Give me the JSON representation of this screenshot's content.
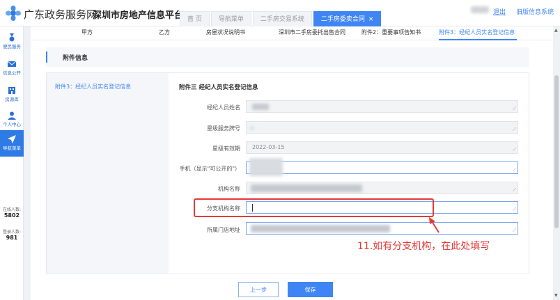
{
  "header": {
    "brand": "广东政务服务网",
    "platform": "深圳市房地产信息平台",
    "logout": "退出",
    "old_system": "旧版信息系统",
    "tabs": [
      {
        "label": "首 页"
      },
      {
        "label": "导航菜单"
      },
      {
        "label": "二手房交易系统"
      },
      {
        "label": "二手房委卖合同",
        "close": "×"
      }
    ]
  },
  "sidebar": {
    "items": [
      {
        "label": "便民服务",
        "icon": "medal-icon"
      },
      {
        "label": "信息公开",
        "icon": "mail-icon"
      },
      {
        "label": "房源库",
        "icon": "building-icon"
      },
      {
        "label": "个人中心",
        "icon": "user-icon"
      },
      {
        "label": "导航菜单",
        "icon": "navigation-icon"
      }
    ],
    "online_label": "在线人数:",
    "online_value": "5802",
    "login_label": "登录人数:",
    "login_value": "981"
  },
  "subtabs": [
    "甲方",
    "乙方",
    "房屋状况说明书",
    "深圳市二手房委托出售合同",
    "附件2：重要事项告知书",
    "附件3：经纪人员实名登记信息"
  ],
  "section": {
    "title": "附件信息"
  },
  "panel": {
    "left_nav": "附件3：经纪人员实名登记信息",
    "title": "附件三  经纪人员实名登记信息",
    "fields": [
      {
        "label": "经纪人员姓名",
        "value": ""
      },
      {
        "label": "星级服务牌号",
        "value": ""
      },
      {
        "label": "星级有效期",
        "value": "2022-03-15"
      },
      {
        "label": "手机（显示\"可公开的\"）",
        "value": ""
      },
      {
        "label": "机构名称",
        "value": ""
      },
      {
        "label": "分支机构名称",
        "value": ""
      },
      {
        "label": "所属门店地址",
        "value": ""
      }
    ]
  },
  "annotation": "11.如有分支机构，在此处填写",
  "buttons": {
    "prev": "上一步",
    "save": "保存"
  },
  "colors": {
    "accent": "#3f86f4",
    "annotation": "#e53935"
  }
}
